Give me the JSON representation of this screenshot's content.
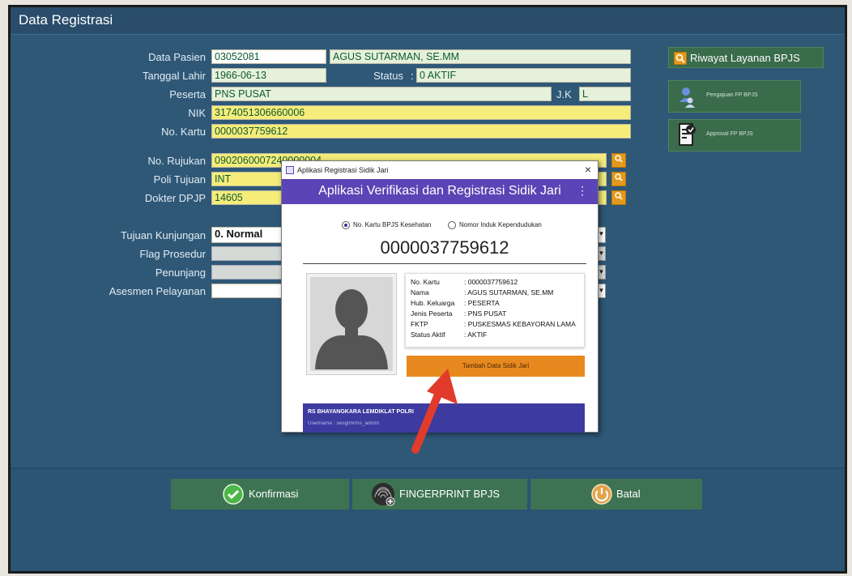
{
  "window": {
    "title": "Data Registrasi"
  },
  "form": {
    "data_pasien_label": "Data Pasien",
    "data_pasien_no": "03052081",
    "data_pasien_nama": "AGUS SUTARMAN, SE.MM",
    "tanggal_lahir_label": "Tanggal Lahir",
    "tanggal_lahir": "1966-06-13",
    "status_label": "Status",
    "status_value": "0 AKTIF",
    "peserta_label": "Peserta",
    "peserta_value": "PNS PUSAT",
    "jk_label": "J.K",
    "jk_value": "L",
    "nik_label": "NIK",
    "nik_value": "3174051306660006",
    "no_kartu_label": "No. Kartu",
    "no_kartu_value": "0000037759612",
    "no_rujukan_label": "No. Rujukan",
    "no_rujukan_value": "0902060007240000004",
    "poli_tujuan_label": "Poli Tujuan",
    "poli_tujuan_value": "INT",
    "dokter_dpjp_label": "Dokter DPJP",
    "dokter_dpjp_value": "14605",
    "tujuan_kunjungan_label": "Tujuan Kunjungan",
    "tujuan_kunjungan_value": "0. Normal",
    "flag_prosedur_label": "Flag Prosedur",
    "penunjang_label": "Penunjang",
    "asesmen_pelayanan_label": "Asesmen Pelayanan"
  },
  "side": {
    "riwayat_label": "Riwayat Layanan BPJS",
    "pengajuan_label": "Pengajuan FP BPJS",
    "approval_label": "Approval FP BPJS"
  },
  "footer": {
    "konfirmasi_label": "Konfirmasi",
    "fingerprint_label": "FINGERPRINT BPJS",
    "batal_label": "Batal"
  },
  "dialog": {
    "window_title": "Aplikasi Registrasi Sidik Jari",
    "close_glyph": "×",
    "header_title": "Aplikasi Verifikasi dan Registrasi Sidik Jari",
    "menu_glyph": "⋮",
    "radio_option_1": "No. Kartu BPJS Kesehatan",
    "radio_option_2": "Nomor Induk Kependudukan",
    "card_number": "0000037759612",
    "info": [
      {
        "key": "No. Kartu",
        "value": ": 0000037759612"
      },
      {
        "key": "Nama",
        "value": ": AGUS SUTARMAN, SE.MM"
      },
      {
        "key": "Hub. Keluarga",
        "value": ": PESERTA"
      },
      {
        "key": "Jenis Peserta",
        "value": ": PNS PUSAT"
      },
      {
        "key": "FKTP",
        "value": ": PUSKESMAS KEBAYORAN LAMA"
      },
      {
        "key": "Status Aktif",
        "value": ": AKTIF"
      }
    ],
    "add_fingerprint_button": "Tambah Data Sidik Jari",
    "footer_org": "RS BHAYANGKARA LEMDIKLAT POLRI",
    "footer_user": "Username : sesgimrms_admin"
  },
  "colors": {
    "screen_bg": "#2f5877",
    "dialog_header": "#5b44b5",
    "orange_button": "#e8891f",
    "footer_band": "#3d3aa0",
    "field_yellow": "#f6ec7a",
    "arrow_red": "#e03b2b"
  },
  "icons": {
    "search": "magnifier",
    "confirm": "check-circle",
    "fingerprint": "fingerprint",
    "cancel": "power-circle"
  }
}
